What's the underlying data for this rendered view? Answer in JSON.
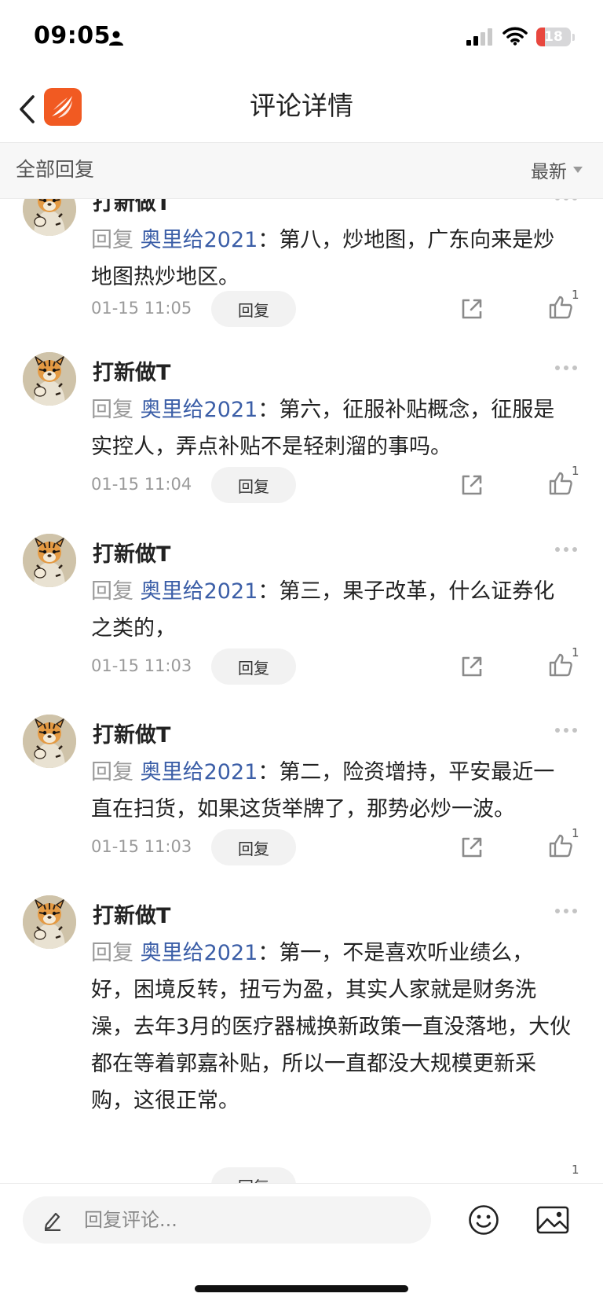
{
  "status_bar": {
    "time": "09:05",
    "battery": "18",
    "battery_level": 0.18,
    "battery_color": "#e8473e"
  },
  "header": {
    "title": "评论详情",
    "logo_color": "#f15a22"
  },
  "filter": {
    "label": "全部回复",
    "sort": "最新"
  },
  "comments": [
    {
      "username": "打新做T",
      "reply_prefix": "回复",
      "mention": "奥里给2021",
      "separator": "：",
      "text": "第八，炒地图，广东向来是炒地图热炒地区。",
      "time": "01-15 11:05",
      "reply_label": "回复",
      "likes": "1"
    },
    {
      "username": "打新做T",
      "reply_prefix": "回复",
      "mention": "奥里给2021",
      "separator": "：",
      "text": "第六，征服补贴概念，征服是实控人，弄点补贴不是轻刺溜的事吗。",
      "time": "01-15 11:04",
      "reply_label": "回复",
      "likes": "1"
    },
    {
      "username": "打新做T",
      "reply_prefix": "回复",
      "mention": "奥里给2021",
      "separator": "：",
      "text": "第三，果子改革，什么证券化之类的，",
      "time": "01-15 11:03",
      "reply_label": "回复",
      "likes": "1"
    },
    {
      "username": "打新做T",
      "reply_prefix": "回复",
      "mention": "奥里给2021",
      "separator": "：",
      "text": "第二，险资增持，平安最近一直在扫货，如果这货举牌了，那势必炒一波。",
      "time": "01-15 11:03",
      "reply_label": "回复",
      "likes": "1"
    },
    {
      "username": "打新做T",
      "reply_prefix": "回复",
      "mention": "奥里给2021",
      "separator": "：",
      "text": "第一，不是喜欢听业绩么，好，困境反转，扭亏为盈，其实人家就是财务洗澡，去年3月的医疗器械换新政策一直没落地，大伙都在等着郭嘉补贴，所以一直都没大规模更新采购，这很正常。",
      "time": "",
      "reply_label": "回复",
      "likes": "1"
    }
  ],
  "bottom_bar": {
    "placeholder": "回复评论..."
  },
  "icons": {
    "back": "back-icon",
    "logo": "app-logo-icon",
    "more": "more-icon",
    "share": "share-icon",
    "like": "like-icon",
    "pencil": "pencil-icon",
    "emoji": "emoji-icon",
    "image": "image-icon",
    "avatar": "tiger-avatar"
  },
  "colors": {
    "mention": "#3b5ea7",
    "muted": "#9a9a9a",
    "accent": "#f15a22"
  }
}
